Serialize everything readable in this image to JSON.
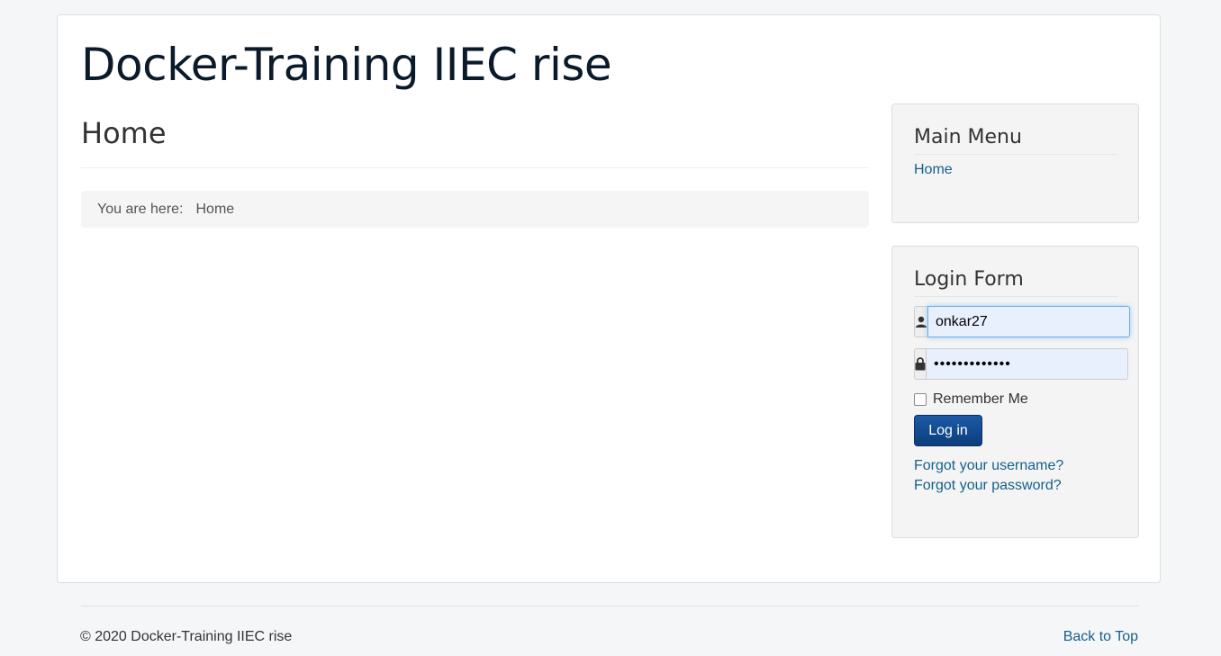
{
  "site": {
    "title": "Docker-Training IIEC rise"
  },
  "main": {
    "heading": "Home",
    "breadcrumb": {
      "label": "You are here:",
      "current": "Home"
    }
  },
  "main_menu": {
    "title": "Main Menu",
    "items": [
      {
        "label": "Home"
      }
    ]
  },
  "login_form": {
    "title": "Login Form",
    "username": {
      "value": "onkar27",
      "icon": "user-icon"
    },
    "password": {
      "value": "•••••••••••••",
      "icon": "lock-icon"
    },
    "remember_label": "Remember Me",
    "remember_checked": false,
    "submit_label": "Log in",
    "forgot_username": "Forgot your username?",
    "forgot_password": "Forgot your password?"
  },
  "footer": {
    "copyright": "© 2020 Docker-Training IIEC rise",
    "back_to_top": "Back to Top"
  },
  "colors": {
    "link": "#15608c",
    "button": "#0b3d7c",
    "background": "#f4f6f7"
  }
}
